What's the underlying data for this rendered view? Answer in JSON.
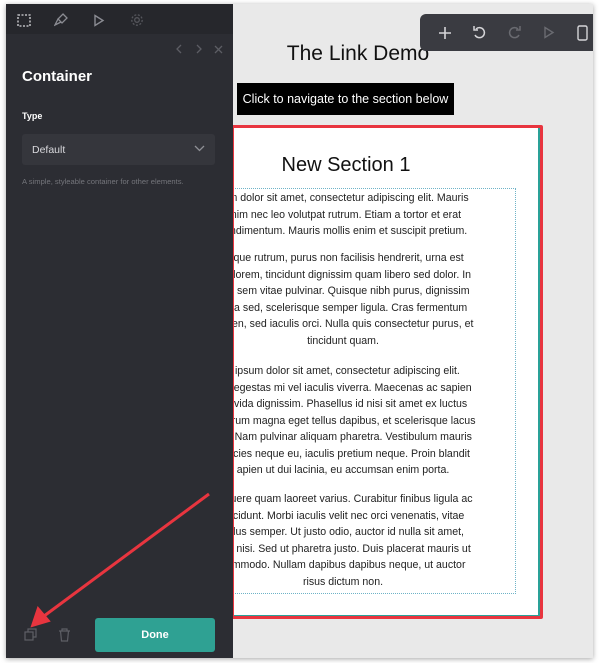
{
  "toolbar": {
    "icons": [
      "plus-icon",
      "undo-icon",
      "redo-icon",
      "play-icon",
      "mobile-preview-icon"
    ]
  },
  "sidebar": {
    "tabs": [
      "selection-icon",
      "paint-brush-icon",
      "play-icon",
      "gear-icon"
    ],
    "title": "Container",
    "type_label": "Type",
    "type_value": "Default",
    "description": "A simple, styleable container for other elements.",
    "done_label": "Done"
  },
  "page": {
    "heading": "The Link Demo",
    "nav_button": "Click to navigate to the section below"
  },
  "section": {
    "title": "New Section 1",
    "paragraphs": [
      [
        "sum dolor sit amet, consectetur adipiscing elit. Mauris",
        "enim nec leo volutpat rutrum. Etiam a tortor et erat",
        "condimentum. Mauris mollis enim et suscipit pretium."
      ],
      [
        "esque rutrum, purus non facilisis hendrerit, urna est",
        "per lorem, tincidunt dignissim quam libero sed dolor. In",
        "non sem vitae pulvinar. Quisque nibh purus, dignissim",
        "urna sed, scelerisque semper ligula. Cras fermentum",
        "sapien, sed iaculis orci. Nulla quis consectetur purus, et",
        "tincidunt quam."
      ],
      [
        "n ipsum dolor sit amet, consectetur adipiscing elit.",
        "sse egestas mi vel iaculis viverra. Maecenas ac sapien",
        "gravida dignissim. Phasellus id nisi sit amet ex luctus",
        "d rutrum magna eget tellus dapibus, et scelerisque lacus",
        "um. Nam pulvinar aliquam pharetra. Vestibulum mauris",
        "ultricies neque eu, iaculis pretium neque. Proin blandit",
        "apien ut dui lacinia, eu accumsan enim porta."
      ],
      [
        "posuere quam laoreet varius. Curabitur finibus ligula ac",
        "tincidunt. Morbi iaculis velit nec orci venenatis, vitae",
        "tellus semper. Ut justo odio, auctor id nulla sit amet,",
        "reet nisi. Sed ut pharetra justo. Duis placerat mauris ut",
        "commodo. Nullam dapibus dapibus neque, ut auctor",
        "risus dictum non."
      ]
    ]
  },
  "colors": {
    "sidebar_bg": "#2c2d33",
    "accent": "#2fa193",
    "annotation": "#e8353f"
  }
}
